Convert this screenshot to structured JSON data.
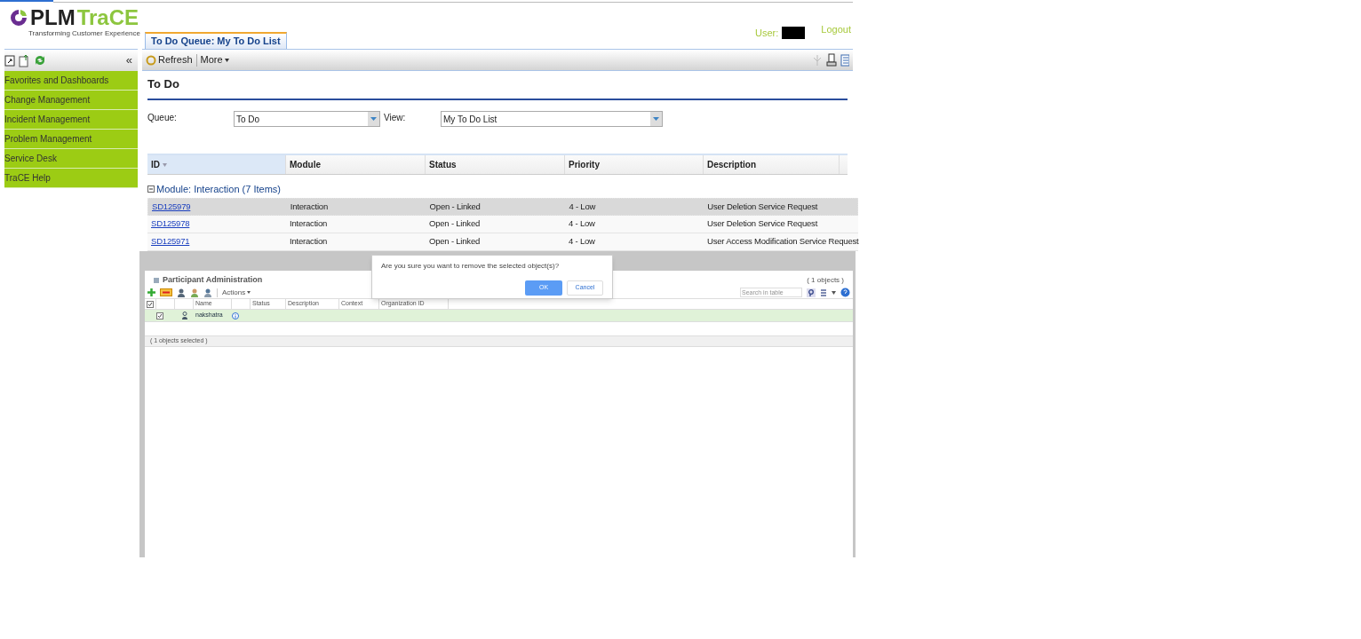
{
  "header": {
    "logo_prefix": "PLM",
    "logo_suffix": "TraCE",
    "tagline": "Transforming Customer Experience",
    "user_label": "User:",
    "logout": "Logout"
  },
  "tabs": [
    {
      "label": "To Do Queue: My To Do List",
      "selected": true
    }
  ],
  "sidebar": {
    "collapse": "«",
    "items": [
      {
        "label": "Favorites and Dashboards"
      },
      {
        "label": "Change Management"
      },
      {
        "label": "Incident Management"
      },
      {
        "label": "Problem Management"
      },
      {
        "label": "Service Desk"
      },
      {
        "label": "TraCE Help"
      }
    ]
  },
  "toolbar": {
    "refresh": "Refresh",
    "more": "More"
  },
  "page_title": "To Do",
  "filters": [
    {
      "label": "Queue:",
      "value": "To Do"
    },
    {
      "label": "View:",
      "value": "My To Do List"
    }
  ],
  "table": {
    "columns": [
      {
        "label": "ID",
        "sorted": true
      },
      {
        "label": "Module",
        "sorted": false
      },
      {
        "label": "Status",
        "sorted": false
      },
      {
        "label": "Priority",
        "sorted": false
      },
      {
        "label": "Description",
        "sorted": false
      }
    ],
    "group": {
      "label": "Module: Interaction (7 Items)",
      "expanded": true
    },
    "rows": [
      {
        "id": "SD125979",
        "module": "Interaction",
        "status": "Open - Linked",
        "priority": "4 - Low",
        "description": "User Deletion Service Request",
        "selected": true
      },
      {
        "id": "SD125978",
        "module": "Interaction",
        "status": "Open - Linked",
        "priority": "4 - Low",
        "description": "User Deletion Service Request",
        "selected": false
      },
      {
        "id": "SD125971",
        "module": "Interaction",
        "status": "Open - Linked",
        "priority": "4 - Low",
        "description": "User Access Modification Service Request",
        "selected": false
      }
    ]
  },
  "participant_panel": {
    "title": "Participant Administration",
    "count": "( 1 objects )",
    "actions": "Actions",
    "search": {
      "placeholder": "Search in table"
    },
    "columns": [
      "Name",
      "Status",
      "Description",
      "Context",
      "Organization ID"
    ],
    "rows": [
      {
        "name": "nakshatra",
        "checked": true
      }
    ],
    "footer": "( 1 objects selected )"
  },
  "dialog": {
    "message": "Are you sure you want to remove the selected object(s)?",
    "buttons": [
      {
        "label": "OK",
        "primary": true
      },
      {
        "label": "Cancel",
        "primary": false
      }
    ]
  }
}
